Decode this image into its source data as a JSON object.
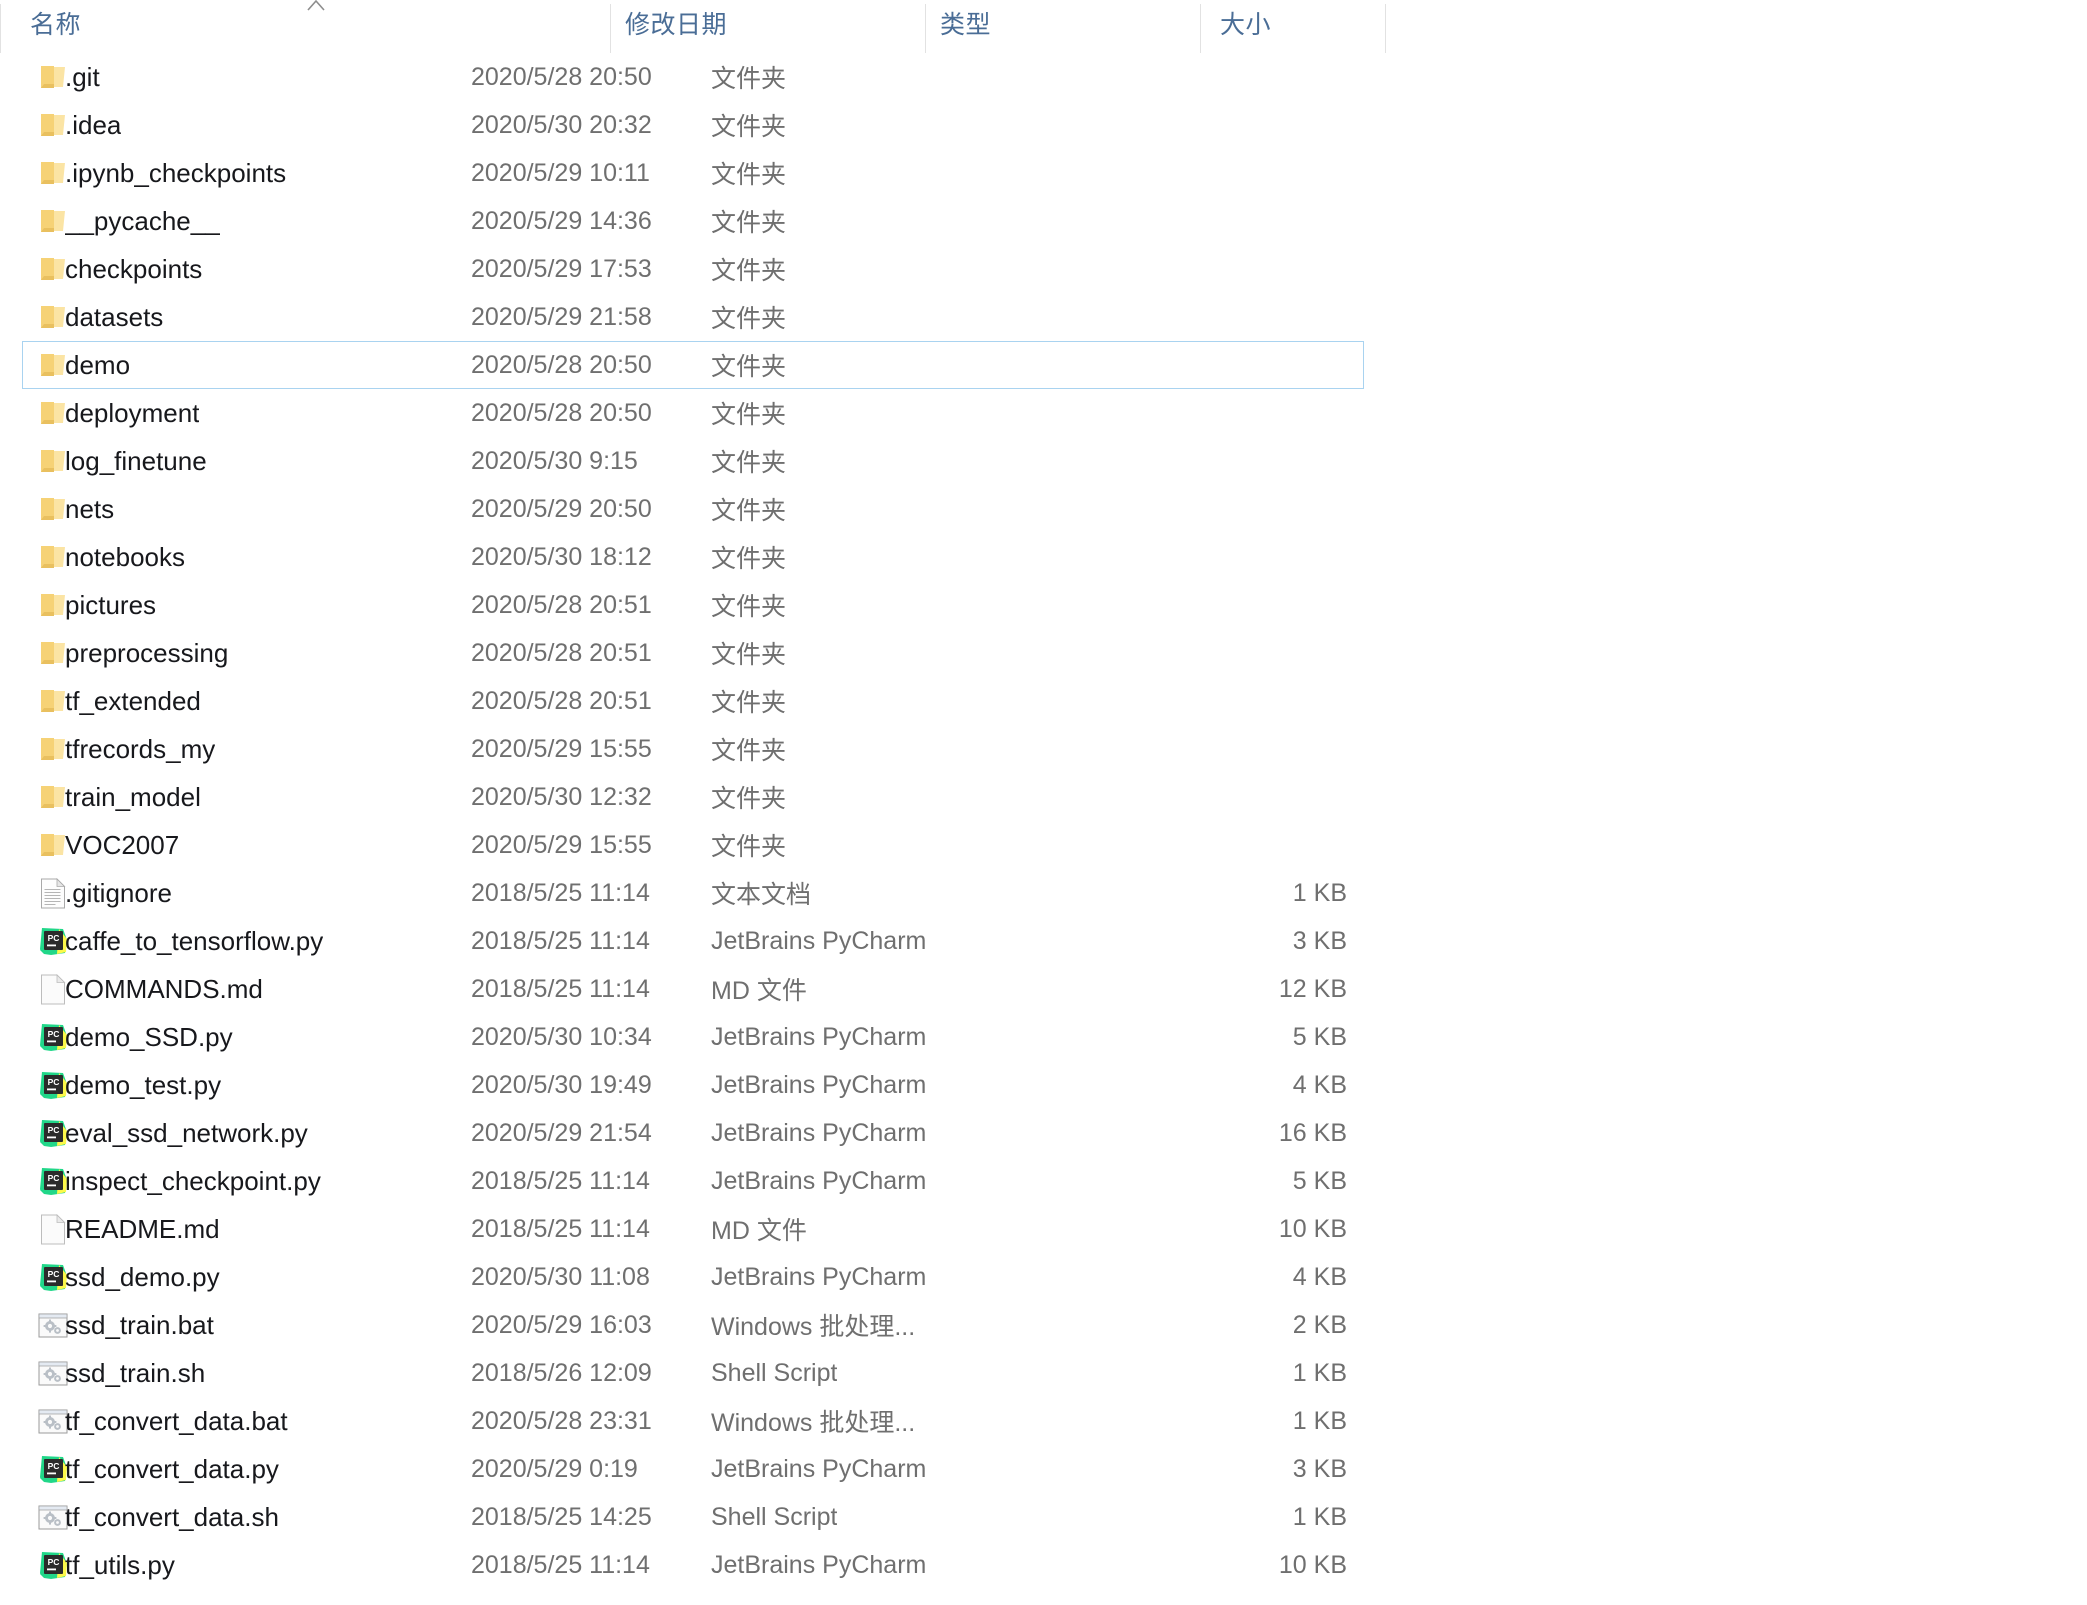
{
  "window": {
    "view": "details-list",
    "background": "#ffffff",
    "selection_border_color": "#a9d3f0",
    "header_text_color": "#4a6d96",
    "secondary_text_color": "#6f6f6f",
    "primary_text_color": "#17181c",
    "folder_icon_color": "#f7d379",
    "pycharm_icon_colors": [
      "#21d789",
      "#fcf84a",
      "#2d2d2d"
    ]
  },
  "columns": [
    {
      "id": "name",
      "label": "名称",
      "sort": "ascending",
      "sort_icon": "chevron-up-icon"
    },
    {
      "id": "date",
      "label": "修改日期"
    },
    {
      "id": "type",
      "label": "类型"
    },
    {
      "id": "size",
      "label": "大小"
    }
  ],
  "files": [
    {
      "icon": "folder-icon",
      "name": ".git",
      "date": "2020/5/28 20:50",
      "type": "文件夹",
      "size": "",
      "selected": false
    },
    {
      "icon": "folder-icon",
      "name": ".idea",
      "date": "2020/5/30 20:32",
      "type": "文件夹",
      "size": "",
      "selected": false
    },
    {
      "icon": "folder-icon",
      "name": ".ipynb_checkpoints",
      "date": "2020/5/29 10:11",
      "type": "文件夹",
      "size": "",
      "selected": false
    },
    {
      "icon": "folder-icon",
      "name": "__pycache__",
      "date": "2020/5/29 14:36",
      "type": "文件夹",
      "size": "",
      "selected": false
    },
    {
      "icon": "folder-icon",
      "name": "checkpoints",
      "date": "2020/5/29 17:53",
      "type": "文件夹",
      "size": "",
      "selected": false
    },
    {
      "icon": "folder-icon",
      "name": "datasets",
      "date": "2020/5/29 21:58",
      "type": "文件夹",
      "size": "",
      "selected": false
    },
    {
      "icon": "folder-icon",
      "name": "demo",
      "date": "2020/5/28 20:50",
      "type": "文件夹",
      "size": "",
      "selected": true
    },
    {
      "icon": "folder-icon",
      "name": "deployment",
      "date": "2020/5/28 20:50",
      "type": "文件夹",
      "size": "",
      "selected": false
    },
    {
      "icon": "folder-icon",
      "name": "log_finetune",
      "date": "2020/5/30 9:15",
      "type": "文件夹",
      "size": "",
      "selected": false
    },
    {
      "icon": "folder-icon",
      "name": "nets",
      "date": "2020/5/29 20:50",
      "type": "文件夹",
      "size": "",
      "selected": false
    },
    {
      "icon": "folder-icon",
      "name": "notebooks",
      "date": "2020/5/30 18:12",
      "type": "文件夹",
      "size": "",
      "selected": false
    },
    {
      "icon": "folder-icon",
      "name": "pictures",
      "date": "2020/5/28 20:51",
      "type": "文件夹",
      "size": "",
      "selected": false
    },
    {
      "icon": "folder-icon",
      "name": "preprocessing",
      "date": "2020/5/28 20:51",
      "type": "文件夹",
      "size": "",
      "selected": false
    },
    {
      "icon": "folder-icon",
      "name": "tf_extended",
      "date": "2020/5/28 20:51",
      "type": "文件夹",
      "size": "",
      "selected": false
    },
    {
      "icon": "folder-icon",
      "name": "tfrecords_my",
      "date": "2020/5/29 15:55",
      "type": "文件夹",
      "size": "",
      "selected": false
    },
    {
      "icon": "folder-icon",
      "name": "train_model",
      "date": "2020/5/30 12:32",
      "type": "文件夹",
      "size": "",
      "selected": false
    },
    {
      "icon": "folder-icon",
      "name": "VOC2007",
      "date": "2020/5/29 15:55",
      "type": "文件夹",
      "size": "",
      "selected": false
    },
    {
      "icon": "text-document-icon",
      "name": ".gitignore",
      "date": "2018/5/25 11:14",
      "type": "文本文档",
      "size": "1 KB",
      "selected": false
    },
    {
      "icon": "pycharm-icon",
      "name": "caffe_to_tensorflow.py",
      "date": "2018/5/25 11:14",
      "type": "JetBrains PyCharm",
      "size": "3 KB",
      "selected": false
    },
    {
      "icon": "blank-page-icon",
      "name": "COMMANDS.md",
      "date": "2018/5/25 11:14",
      "type": "MD 文件",
      "size": "12 KB",
      "selected": false
    },
    {
      "icon": "pycharm-icon",
      "name": "demo_SSD.py",
      "date": "2020/5/30 10:34",
      "type": "JetBrains PyCharm",
      "size": "5 KB",
      "selected": false
    },
    {
      "icon": "pycharm-icon",
      "name": "demo_test.py",
      "date": "2020/5/30 19:49",
      "type": "JetBrains PyCharm",
      "size": "4 KB",
      "selected": false
    },
    {
      "icon": "pycharm-icon",
      "name": "eval_ssd_network.py",
      "date": "2020/5/29 21:54",
      "type": "JetBrains PyCharm",
      "size": "16 KB",
      "selected": false
    },
    {
      "icon": "pycharm-icon",
      "name": "inspect_checkpoint.py",
      "date": "2018/5/25 11:14",
      "type": "JetBrains PyCharm",
      "size": "5 KB",
      "selected": false
    },
    {
      "icon": "blank-page-icon",
      "name": "README.md",
      "date": "2018/5/25 11:14",
      "type": "MD 文件",
      "size": "10 KB",
      "selected": false
    },
    {
      "icon": "pycharm-icon",
      "name": "ssd_demo.py",
      "date": "2020/5/30 11:08",
      "type": "JetBrains PyCharm",
      "size": "4 KB",
      "selected": false
    },
    {
      "icon": "batch-file-icon",
      "name": "ssd_train.bat",
      "date": "2020/5/29 16:03",
      "type": "Windows 批处理...",
      "size": "2 KB",
      "selected": false
    },
    {
      "icon": "batch-file-icon",
      "name": "ssd_train.sh",
      "date": "2018/5/26 12:09",
      "type": "Shell Script",
      "size": "1 KB",
      "selected": false
    },
    {
      "icon": "batch-file-icon",
      "name": "tf_convert_data.bat",
      "date": "2020/5/28 23:31",
      "type": "Windows 批处理...",
      "size": "1 KB",
      "selected": false
    },
    {
      "icon": "pycharm-icon",
      "name": "tf_convert_data.py",
      "date": "2020/5/29 0:19",
      "type": "JetBrains PyCharm",
      "size": "3 KB",
      "selected": false
    },
    {
      "icon": "batch-file-icon",
      "name": "tf_convert_data.sh",
      "date": "2018/5/25 14:25",
      "type": "Shell Script",
      "size": "1 KB",
      "selected": false
    },
    {
      "icon": "pycharm-icon",
      "name": "tf_utils.py",
      "date": "2018/5/25 11:14",
      "type": "JetBrains PyCharm",
      "size": "10 KB",
      "selected": false
    }
  ]
}
